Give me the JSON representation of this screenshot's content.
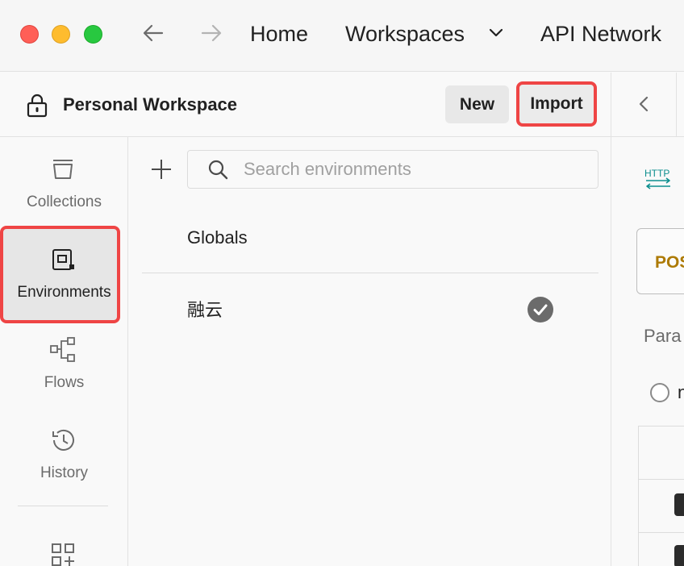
{
  "titlebar": {
    "nav": {
      "home": "Home",
      "workspaces": "Workspaces",
      "api_network": "API Network"
    }
  },
  "workspace": {
    "title": "Personal Workspace",
    "new_label": "New",
    "import_label": "Import"
  },
  "sidebar": {
    "items": [
      {
        "label": "Collections",
        "icon": "collections-icon"
      },
      {
        "label": "Environments",
        "icon": "environments-icon",
        "active": true
      },
      {
        "label": "Flows",
        "icon": "flows-icon"
      },
      {
        "label": "History",
        "icon": "history-icon"
      }
    ]
  },
  "environments": {
    "search_placeholder": "Search environments",
    "items": [
      {
        "label": "Globals",
        "active": false
      },
      {
        "label": "融云",
        "active": true
      }
    ]
  },
  "request": {
    "method": "POS",
    "params_tab": "Para",
    "radio_label": "n"
  },
  "colors": {
    "highlight": "#ef4545",
    "method_post": "#ad7a03",
    "http_icon": "#0e8f8f"
  }
}
